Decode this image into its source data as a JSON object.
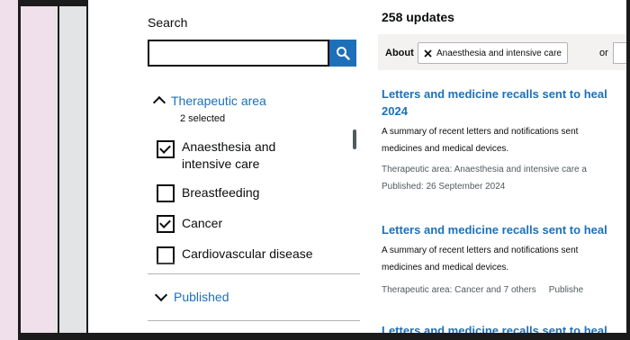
{
  "search": {
    "label": "Search",
    "placeholder": "",
    "button_icon": "search-icon"
  },
  "filters": {
    "therapeutic_area": {
      "title": "Therapeutic area",
      "selected_count": "2 selected",
      "options": [
        {
          "label_line1": "Anaesthesia and",
          "label_line2": "intensive care",
          "checked": true
        },
        {
          "label": "Breastfeeding",
          "checked": false
        },
        {
          "label": "Cancer",
          "checked": true
        },
        {
          "label": "Cardiovascular disease",
          "checked": false
        }
      ]
    },
    "published": {
      "title": "Published"
    }
  },
  "results": {
    "count": "258 updates",
    "about_label": "About",
    "chip_label": "Anaesthesia and intensive care",
    "or_label": "or",
    "items": [
      {
        "title_line1": "Letters and medicine recalls sent to heal",
        "title_line2": "2024",
        "desc_line1": "A summary of recent letters and notifications sent",
        "desc_line2": "medicines and medical devices.",
        "meta_area": "Therapeutic area: Anaesthesia and intensive care a",
        "meta_published": "Published: 26 September 2024"
      },
      {
        "title_line1": "Letters and medicine recalls sent to heal",
        "desc_line1": "A summary of recent letters and notifications sent",
        "desc_line2": "medicines and medical devices.",
        "meta_area": "Therapeutic area: Cancer and 7 others",
        "meta_published": "Publishe"
      },
      {
        "title_line1": "Letters and medicine recalls sent to heal"
      }
    ]
  },
  "colors": {
    "link": "#1d70b8",
    "text": "#0b0c0c",
    "secondary_text": "#505a5f",
    "about_bar": "#f3f2f1",
    "pink_edge": "#efe0eb"
  }
}
